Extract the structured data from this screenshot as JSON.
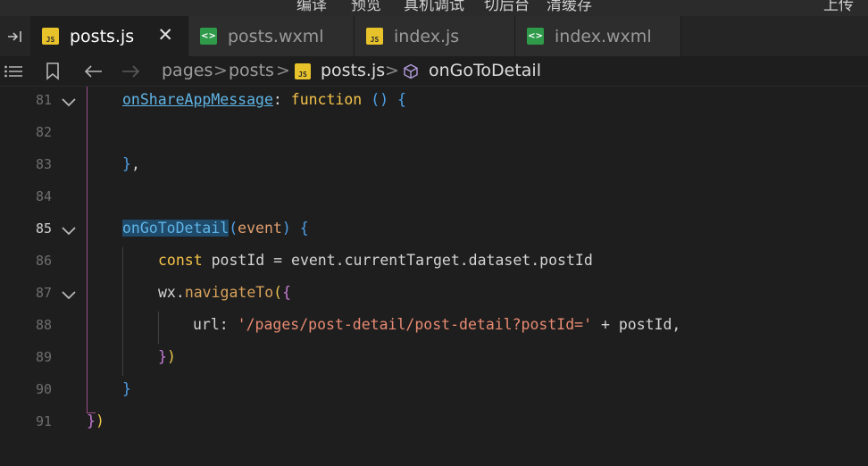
{
  "toolbar": {
    "items": [
      "编译",
      "预览",
      "真机调试",
      "切后台",
      "清缓存"
    ],
    "right_label": "上传"
  },
  "tabs": [
    {
      "label": "posts.js",
      "type": "js",
      "active": true,
      "closable": true
    },
    {
      "label": "posts.wxml",
      "type": "wxml",
      "active": false
    },
    {
      "label": "index.js",
      "type": "js",
      "active": false
    },
    {
      "label": "index.wxml",
      "type": "wxml",
      "active": false
    }
  ],
  "file_icons": {
    "js": "JS",
    "wxml": "<>"
  },
  "breadcrumb": {
    "segments": [
      "pages",
      "posts",
      "posts.js",
      "onGoToDetail"
    ],
    "separator": ">"
  },
  "icons": {
    "tab_strip_left": "arrow-into-bar-icon",
    "sidebar_toggle": "list-icon",
    "bookmark": "bookmark-icon",
    "back": "arrow-left-icon",
    "forward": "arrow-right-icon",
    "symbol": "cube-icon",
    "close": "close-icon",
    "fold": "chevron-down-icon"
  },
  "editor": {
    "current_line": "85",
    "lines": [
      {
        "n": "81",
        "fold": true,
        "tokens": [
          [
            "fn ul",
            "onShareAppMessage"
          ],
          [
            "punc",
            ": "
          ],
          [
            "kw",
            "function"
          ],
          [
            "punc",
            " "
          ],
          [
            "brk3",
            "()"
          ],
          [
            "punc",
            " "
          ],
          [
            "brk3",
            "{"
          ]
        ]
      },
      {
        "n": "82",
        "fold": false,
        "tokens": []
      },
      {
        "n": "83",
        "fold": false,
        "tokens": [
          [
            "brk3",
            "}"
          ],
          [
            "punc",
            ","
          ]
        ]
      },
      {
        "n": "84",
        "fold": false,
        "tokens": []
      },
      {
        "n": "85",
        "fold": true,
        "tokens": [
          [
            "fn hl",
            "onGoToDetail"
          ],
          [
            "brk3",
            "("
          ],
          [
            "param",
            "event"
          ],
          [
            "brk3",
            ")"
          ],
          [
            "punc",
            " "
          ],
          [
            "brk3",
            "{"
          ]
        ]
      },
      {
        "n": "86",
        "fold": false,
        "tokens": [
          [
            "kw",
            "const"
          ],
          [
            "id",
            " postId = event.currentTarget.dataset.postId"
          ]
        ]
      },
      {
        "n": "87",
        "fold": true,
        "tokens": [
          [
            "id",
            "wx."
          ],
          [
            "call",
            "navigateTo"
          ],
          [
            "brk1",
            "("
          ],
          [
            "brk2",
            "{"
          ]
        ]
      },
      {
        "n": "88",
        "fold": false,
        "tokens": [
          [
            "id",
            "url: "
          ],
          [
            "str",
            "'/pages/post-detail/post-detail?postId='"
          ],
          [
            "id",
            " + postId,"
          ]
        ]
      },
      {
        "n": "89",
        "fold": false,
        "tokens": [
          [
            "brk2",
            "}"
          ],
          [
            "brk1",
            ")"
          ]
        ]
      },
      {
        "n": "90",
        "fold": false,
        "tokens": [
          [
            "brk3",
            "}"
          ]
        ]
      },
      {
        "n": "91",
        "fold": false,
        "tokens": [
          [
            "brk2",
            "}"
          ],
          [
            "brk1",
            ")"
          ]
        ]
      }
    ]
  },
  "colors": {
    "background": "#1e1e1e",
    "tab_bar": "#252526",
    "keyword": "#f5c34a",
    "function": "#5fb4e6",
    "string": "#e98a72",
    "selection": "#1f4a6a"
  }
}
